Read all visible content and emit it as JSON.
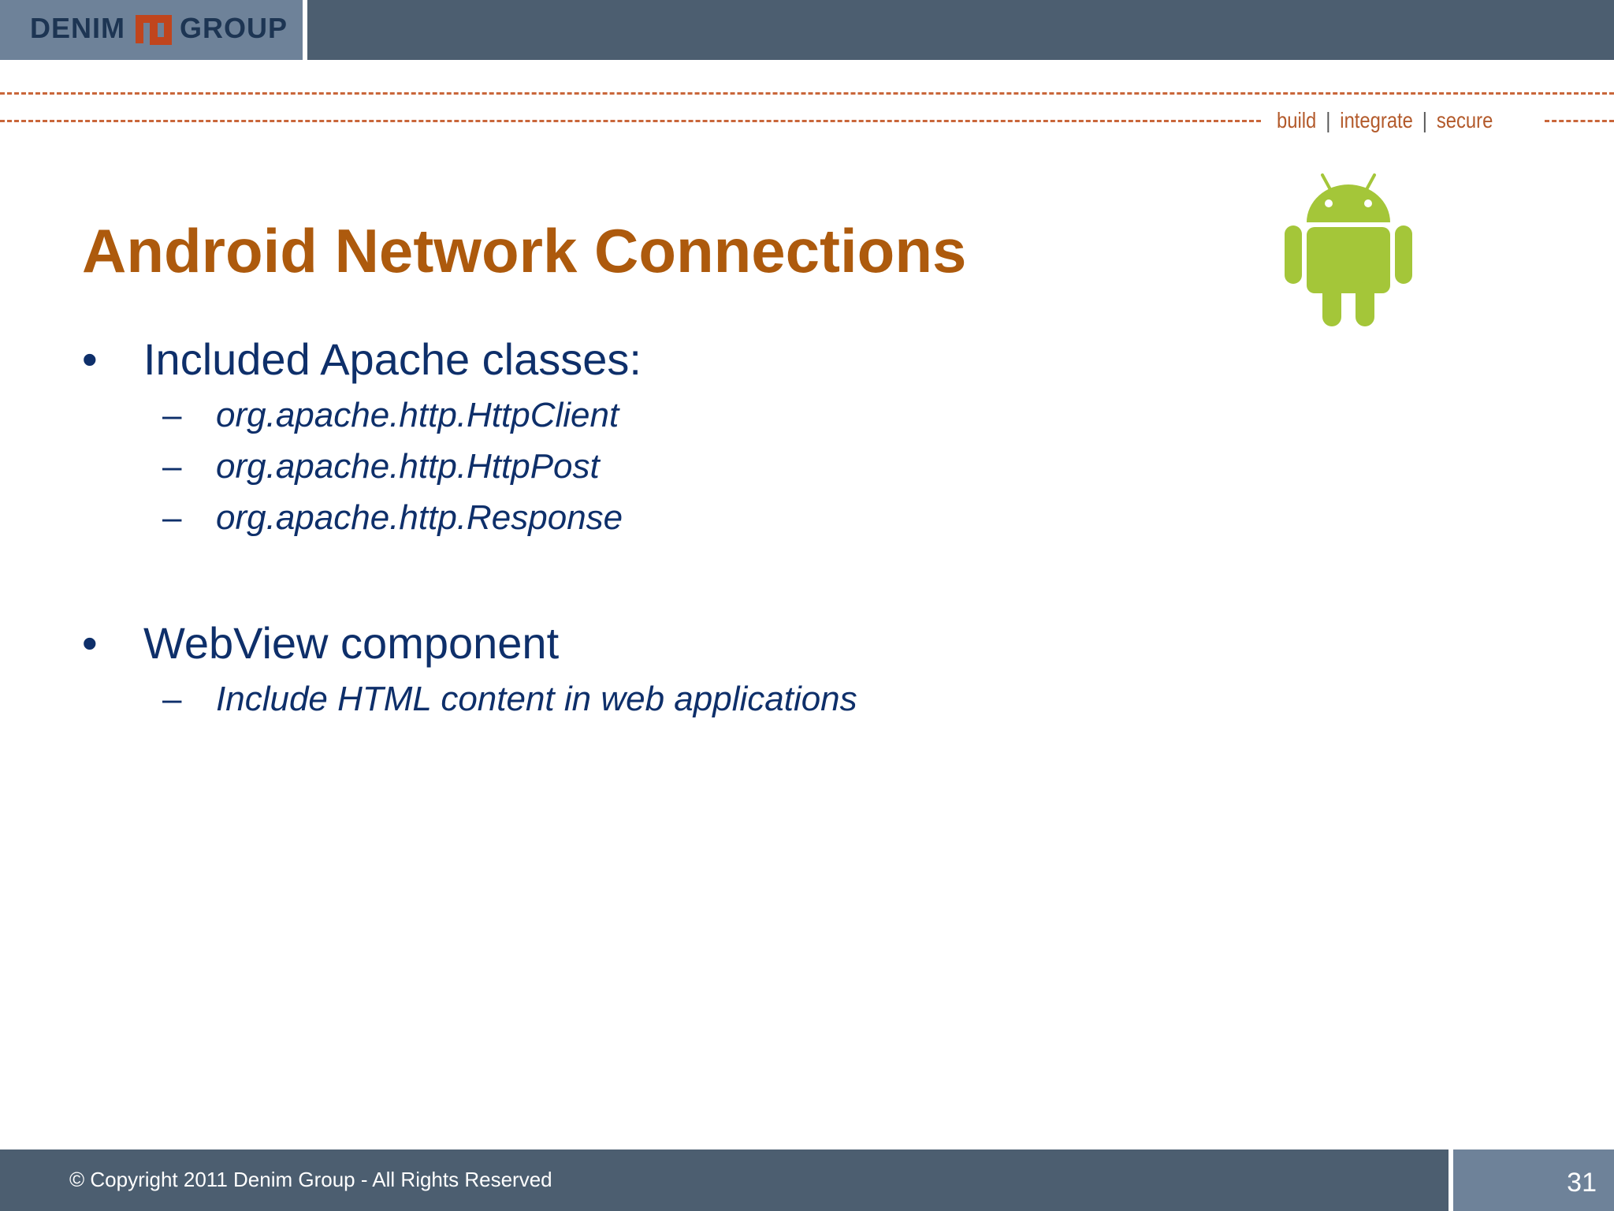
{
  "header": {
    "logo_left": "DENIM",
    "logo_right": "GROUP",
    "tagline": [
      "build",
      "integrate",
      "secure"
    ],
    "tagline_sep": "|"
  },
  "slide": {
    "title": "Android Network Connections",
    "bullets": [
      {
        "marker": "•",
        "text": "Included Apache classes:",
        "subs": [
          {
            "marker": "–",
            "text": "org.apache.http.HttpClient"
          },
          {
            "marker": "–",
            "text": "org.apache.http.HttpPost"
          },
          {
            "marker": "–",
            "text": "org.apache.http.Response"
          }
        ]
      },
      {
        "marker": "•",
        "text": "WebView component",
        "subs": [
          {
            "marker": "–",
            "text": "Include HTML content in web applications"
          }
        ]
      }
    ],
    "logo_icon": "android-robot-icon"
  },
  "footer": {
    "copyright": "© Copyright 2011 Denim Group - All Rights Reserved",
    "page_number": "31"
  },
  "colors": {
    "bar": "#4c5e70",
    "bar_accent": "#6e8299",
    "title": "#ad5a0d",
    "body_text": "#0e2f6a",
    "android_green": "#a4c639",
    "dash_orange": "#c9663a"
  }
}
